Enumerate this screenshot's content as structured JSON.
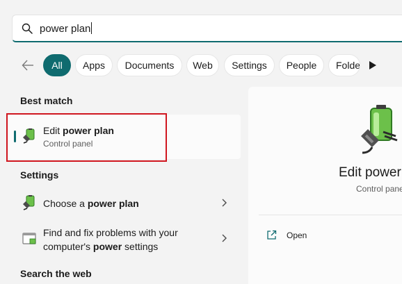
{
  "search": {
    "query": "power plan"
  },
  "filters": {
    "back_icon": "back-arrow-icon",
    "chips": [
      "All",
      "Apps",
      "Documents",
      "Web",
      "Settings",
      "People",
      "Folde"
    ],
    "more_icon": "play-arrow-icon",
    "accent_color": "#0f6b6f"
  },
  "best_match": {
    "heading": "Best match",
    "title_pre": "Edit ",
    "title_bold": "power plan",
    "subtitle": "Control panel",
    "icon": "battery-plug-icon",
    "highlight_color": "#d0161f"
  },
  "settings": {
    "heading": "Settings",
    "items": [
      {
        "pre": "Choose a ",
        "bold": "power plan",
        "post": "",
        "icon": "battery-plug-icon"
      },
      {
        "line1": "Find and fix problems with your",
        "line2_pre": "computer's ",
        "line2_bold": "power",
        "line2_post": " settings",
        "icon": "troubleshoot-icon"
      }
    ]
  },
  "web": {
    "heading": "Search the web"
  },
  "detail": {
    "title": "Edit power",
    "subtitle": "Control pane",
    "icon": "battery-plug-icon",
    "actions": [
      {
        "label": "Open",
        "icon": "open-external-icon"
      }
    ]
  }
}
